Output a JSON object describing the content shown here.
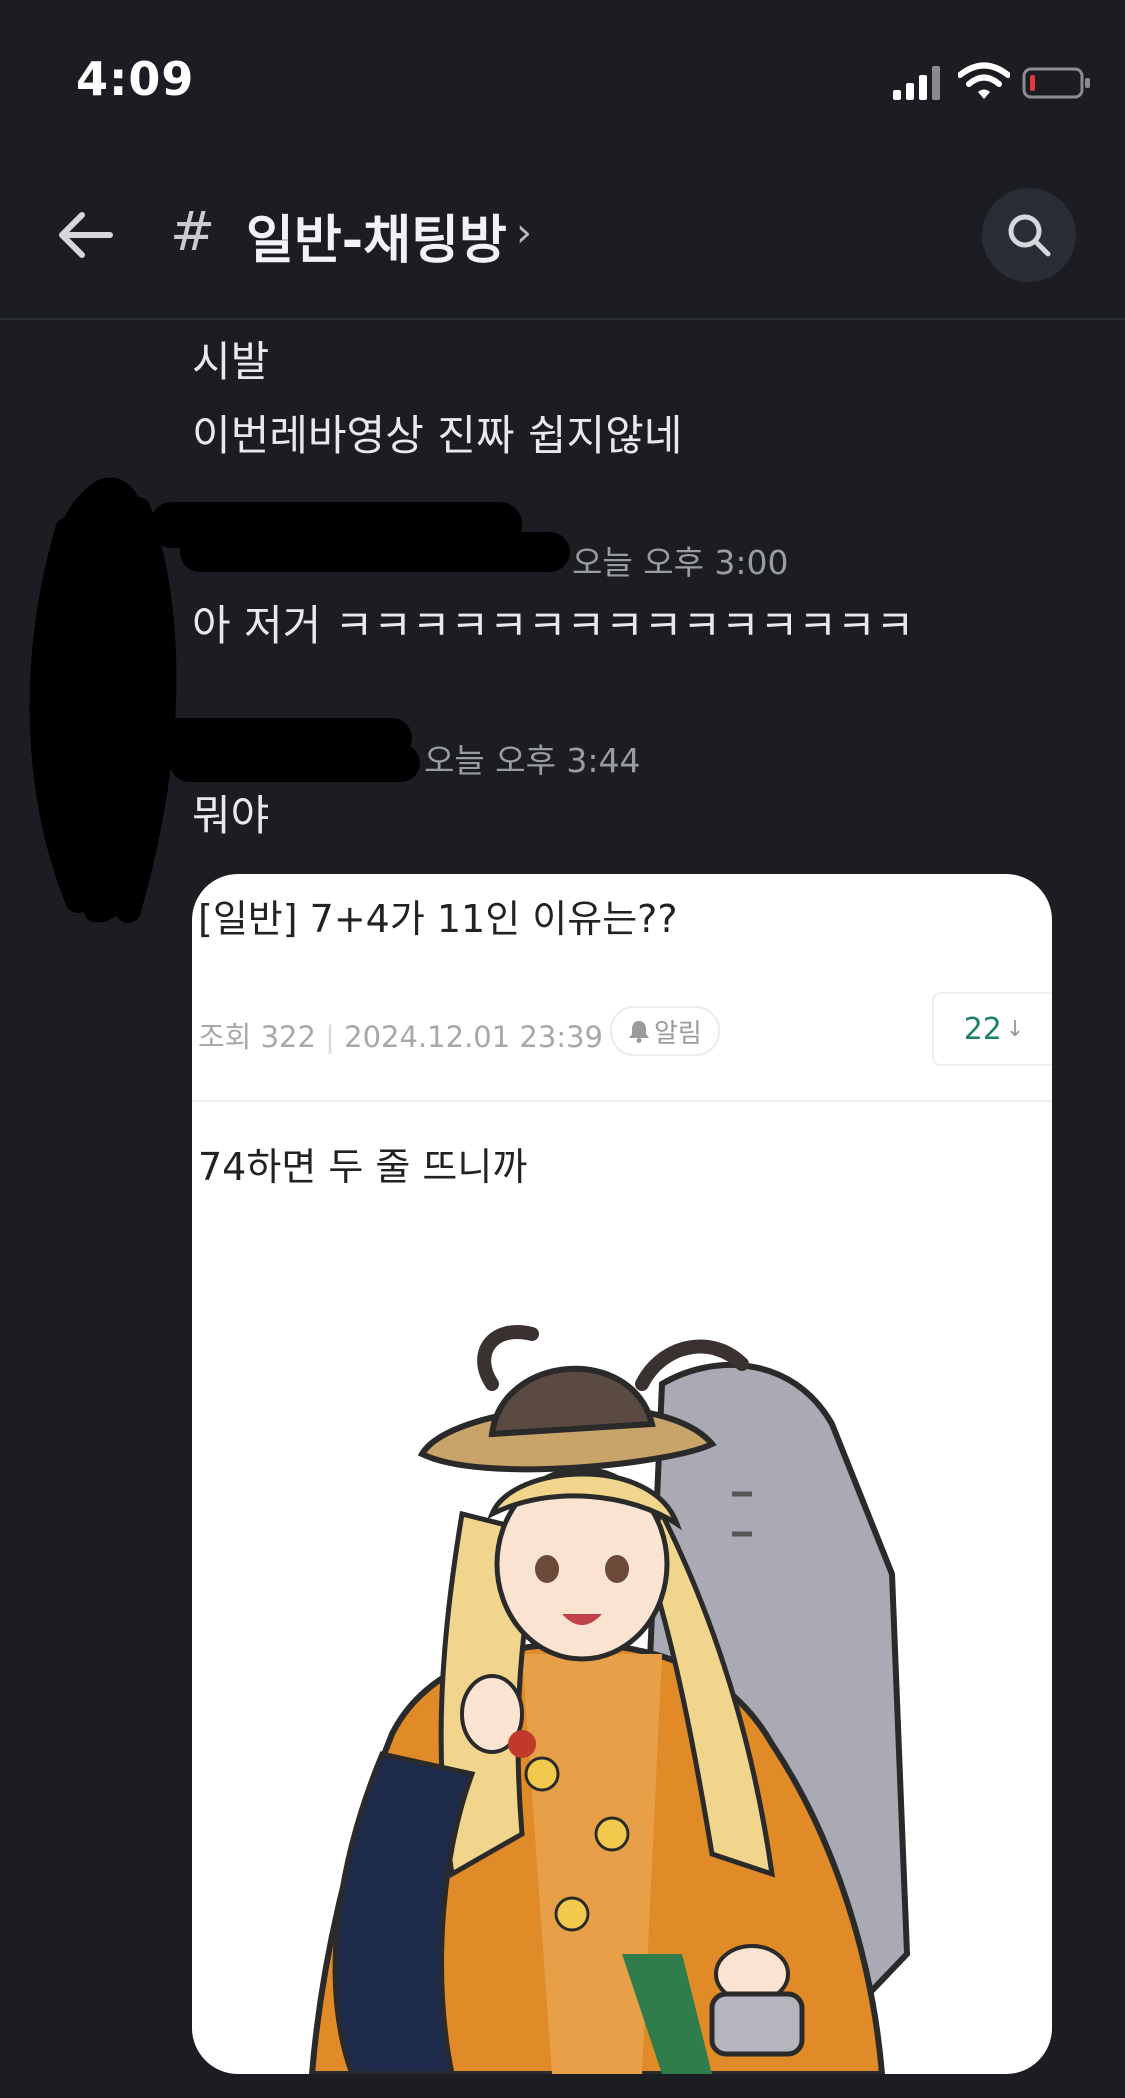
{
  "status_bar": {
    "time": "4:09"
  },
  "header": {
    "hash": "#",
    "channel_name": "일반-채팅방",
    "chevron": "›"
  },
  "messages": [
    {
      "text_lines": [
        "시발",
        "이번레바영상 진짜 쉽지않네"
      ]
    },
    {
      "timestamp": "오늘 오후 3:00",
      "text": "아 저거 ㅋㅋㅋㅋㅋㅋㅋㅋㅋㅋㅋㅋㅋㅋㅋ"
    },
    {
      "timestamp": "오늘 오후 3:44",
      "text": "뭐야"
    }
  ],
  "shared_post": {
    "title": "[일반] 7+4가 11인 이유는??",
    "views": "조회 322",
    "datetime": "2024.12.01 23:39",
    "alarm_label": "알림",
    "comment_count": "22",
    "body": "74하면 두 줄 뜨니까"
  },
  "colors": {
    "background": "#1c1d23",
    "accent": "#1e7f6a"
  }
}
